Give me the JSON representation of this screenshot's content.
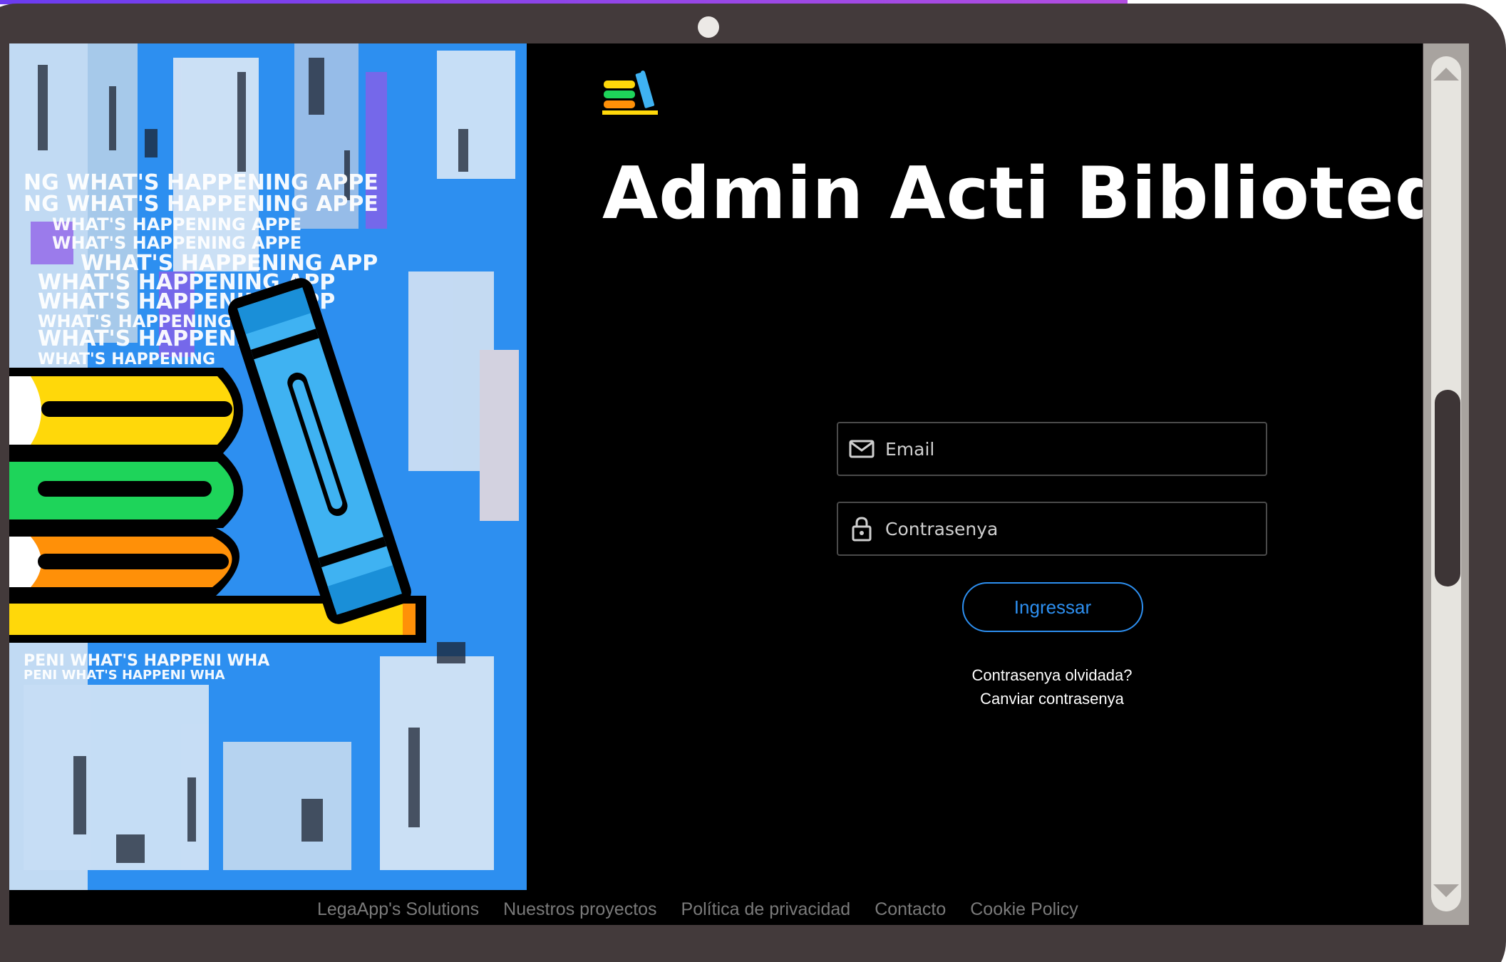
{
  "app": {
    "title": "Admin Acti Bibliotequ",
    "brand_color": "#2d8ff0"
  },
  "login": {
    "email_placeholder": "Email",
    "password_placeholder": "Contrasenya",
    "submit_label": "Ingressar",
    "forgot_label": "Contrasenya olvidada?",
    "change_label": "Canviar contrasenya"
  },
  "hero": {
    "poster_text": "WHAT'S HAPPENING"
  },
  "footer": {
    "links": [
      "LegaApp's Solutions",
      "Nuestros proyectos",
      "Política de privacidad",
      "Contacto",
      "Cookie Policy"
    ]
  },
  "icons": {
    "logo": "books-logo-icon",
    "email": "mail-icon",
    "password": "lock-icon",
    "scroll_up": "triangle-up-icon",
    "scroll_down": "triangle-down-icon"
  },
  "colors": {
    "page_bg": "#000000",
    "device_frame": "#433a3b",
    "field_border": "#4a4a4a",
    "footer_link": "#7a7a7a",
    "hero_blue": "#2d8ff0",
    "book_yellow": "#ffd80a",
    "book_green": "#1ed45a",
    "book_orange": "#ff9008",
    "book_blue": "#3fb2f2"
  }
}
